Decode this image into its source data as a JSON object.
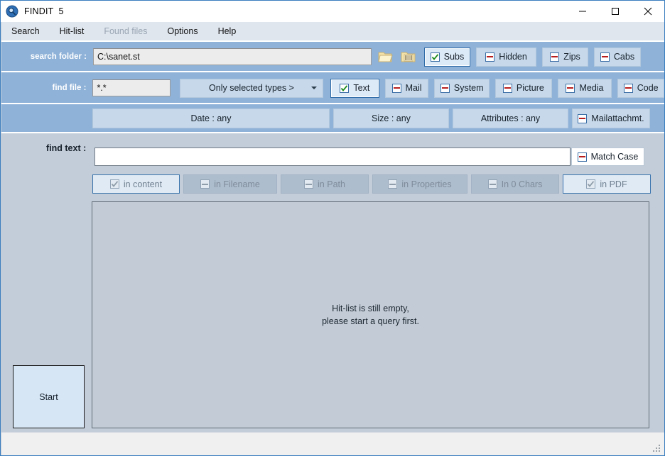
{
  "window": {
    "app_icon": "magnifier-icon",
    "title": "FINDIT",
    "version": "5",
    "minimize_label": "minimize-icon",
    "maximize_label": "maximize-icon",
    "close_label": "close-icon"
  },
  "menubar": {
    "items": [
      {
        "label": "Search",
        "disabled": false
      },
      {
        "label": "Hit-list",
        "disabled": false
      },
      {
        "label": "Found files",
        "disabled": true
      },
      {
        "label": "Options",
        "disabled": false
      },
      {
        "label": "Help",
        "disabled": false
      }
    ]
  },
  "search_folder_row": {
    "label": "search folder :",
    "value": "C:\\sanet.st",
    "placeholder": "",
    "browse_folder_icon": "open-folder-icon",
    "recent_folder_icon": "folder-list-icon",
    "toggles": [
      {
        "label": "Subs",
        "state": "checked",
        "selected": true
      },
      {
        "label": "Hidden",
        "state": "excluded",
        "selected": false
      },
      {
        "label": "Zips",
        "state": "excluded",
        "selected": false
      },
      {
        "label": "Cabs",
        "state": "excluded",
        "selected": false
      }
    ]
  },
  "find_file_row": {
    "label": "find file :",
    "value": "*.*",
    "placeholder": "",
    "types_dropdown": {
      "selected": "Only selected types >",
      "caret": "chevron-down-icon"
    },
    "toggles": [
      {
        "label": "Text",
        "state": "checked",
        "selected": true
      },
      {
        "label": "Mail",
        "state": "excluded",
        "selected": false
      },
      {
        "label": "System",
        "state": "excluded",
        "selected": false
      },
      {
        "label": "Picture",
        "state": "excluded",
        "selected": false
      },
      {
        "label": "Media",
        "state": "excluded",
        "selected": false
      },
      {
        "label": "Code",
        "state": "excluded",
        "selected": false
      }
    ]
  },
  "filters_row": {
    "buttons": [
      {
        "label": "Date : any"
      },
      {
        "label": "Size : any"
      },
      {
        "label": "Attributes : any"
      }
    ],
    "mailattachment": {
      "label": "Mailattachmt.",
      "state": "excluded"
    }
  },
  "find_text_row": {
    "label": "find text :",
    "value": "",
    "placeholder": "",
    "match_case": {
      "label": "Match Case",
      "state": "excluded"
    }
  },
  "scope_row": {
    "toggles": [
      {
        "label": "in content",
        "state": "checked",
        "disabled": true,
        "selected": true
      },
      {
        "label": "in Filename",
        "state": "excluded",
        "disabled": true,
        "selected": false
      },
      {
        "label": "in Path",
        "state": "excluded",
        "disabled": true,
        "selected": false
      },
      {
        "label": "in Properties",
        "state": "excluded",
        "disabled": true,
        "selected": false
      },
      {
        "label": "In 0 Chars",
        "state": "excluded",
        "disabled": true,
        "selected": false
      },
      {
        "label": "in PDF",
        "state": "checked",
        "disabled": true,
        "selected": true
      }
    ]
  },
  "hitlist": {
    "empty_line1": "Hit-list is still empty,",
    "empty_line2": "please start a query first."
  },
  "start_button": {
    "label": "Start"
  },
  "statusbar": {
    "text": "",
    "grip": "resize-grip-icon"
  },
  "colors": {
    "panel_blue": "#8fb2d8",
    "lower_gray": "#c3cdd9",
    "accent_blue": "#2f6ca8",
    "check_green": "#1a8a1a",
    "dash_red": "#b81d1d",
    "window_border": "#3a7ebf"
  }
}
